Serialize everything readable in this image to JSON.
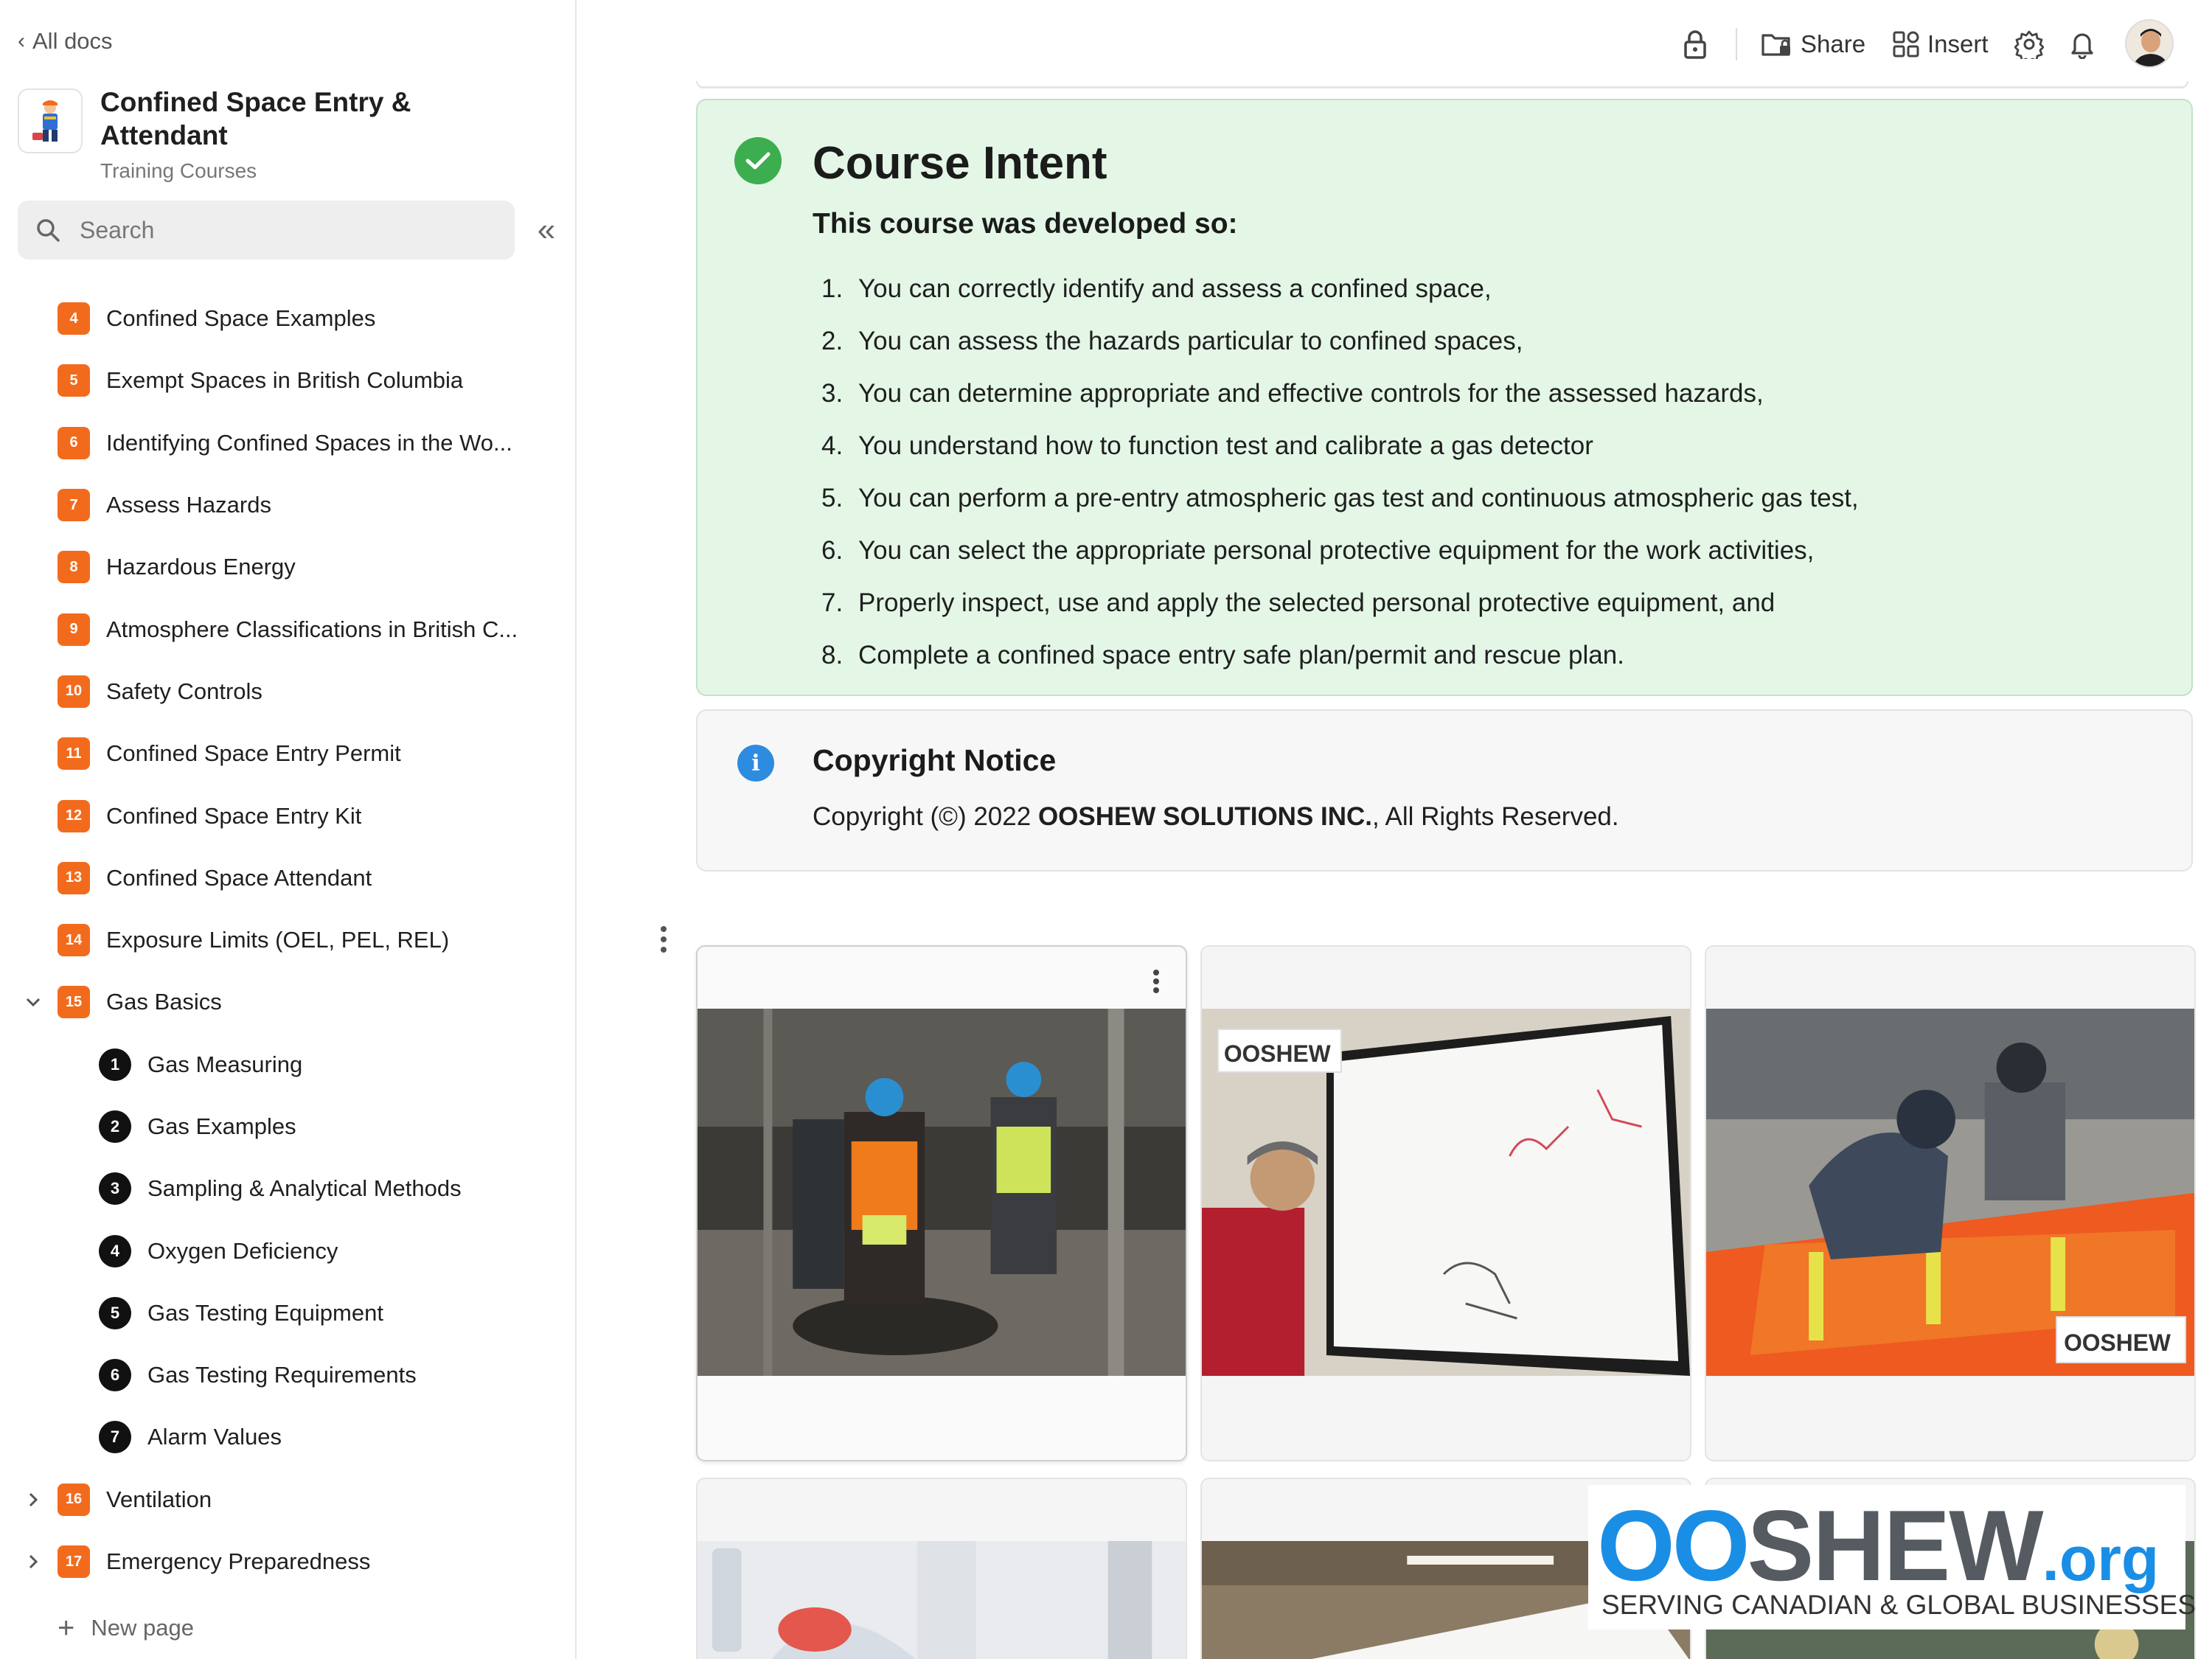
{
  "sidebar": {
    "back_label": "All docs",
    "doc_title": "Confined Space Entry & Attendant",
    "doc_subtitle": "Training Courses",
    "search_placeholder": "Search",
    "items": [
      {
        "num": "4",
        "label": "Confined Space Examples"
      },
      {
        "num": "5",
        "label": "Exempt Spaces in British Columbia"
      },
      {
        "num": "6",
        "label": "Identifying Confined Spaces in the Wo..."
      },
      {
        "num": "7",
        "label": "Assess Hazards"
      },
      {
        "num": "8",
        "label": "Hazardous Energy"
      },
      {
        "num": "9",
        "label": "Atmosphere Classifications in British C..."
      },
      {
        "num": "10",
        "label": "Safety Controls"
      },
      {
        "num": "11",
        "label": "Confined Space Entry Permit"
      },
      {
        "num": "12",
        "label": "Confined Space Entry Kit"
      },
      {
        "num": "13",
        "label": "Confined Space Attendant"
      },
      {
        "num": "14",
        "label": "Exposure Limits (OEL, PEL, REL)"
      },
      {
        "num": "15",
        "label": "Gas Basics"
      },
      {
        "num": "1",
        "label": "Gas Measuring"
      },
      {
        "num": "2",
        "label": "Gas Examples"
      },
      {
        "num": "3",
        "label": "Sampling & Analytical Methods"
      },
      {
        "num": "4",
        "label": "Oxygen Deficiency"
      },
      {
        "num": "5",
        "label": "Gas Testing Equipment"
      },
      {
        "num": "6",
        "label": "Gas Testing Requirements"
      },
      {
        "num": "7",
        "label": "Alarm Values"
      },
      {
        "num": "16",
        "label": "Ventilation"
      },
      {
        "num": "17",
        "label": "Emergency Preparedness"
      }
    ],
    "new_page_label": "New page"
  },
  "topbar": {
    "share_label": "Share",
    "insert_label": "Insert"
  },
  "intent": {
    "title": "Course Intent",
    "subtitle": "This course was developed so:",
    "items": [
      {
        "num": "1.",
        "text": "You can correctly identify and assess a confined space,"
      },
      {
        "num": "2.",
        "text": "You can assess the hazards particular to confined spaces,"
      },
      {
        "num": "3.",
        "text": "You can determine appropriate and effective controls for the assessed hazards,"
      },
      {
        "num": "4.",
        "text": "You understand how to function test and calibrate a gas detector"
      },
      {
        "num": "5.",
        "text": "You can perform a pre-entry atmospheric gas test and continuous atmospheric gas test,"
      },
      {
        "num": "6.",
        "text": "You can select the appropriate personal protective equipment for the work activities,"
      },
      {
        "num": "7.",
        "text": "Properly inspect, use and apply the selected personal protective equipment, and"
      },
      {
        "num": "8.",
        "text": "Complete a confined space entry safe plan/permit and rescue plan."
      }
    ]
  },
  "copyright": {
    "title": "Copyright Notice",
    "text_prefix": "Copyright (©) 2022 ",
    "company": "OOSHEW SOLUTIONS INC.",
    "text_suffix": ", All Rights Reserved."
  },
  "photos": {
    "watermark_small": "OOSHEW"
  },
  "brand": {
    "logo_oo": "OO",
    "logo_shew": "SHEW",
    "logo_tld": ".org",
    "tagline": "SERVING CANADIAN & GLOBAL BUSINESSES"
  },
  "colors": {
    "accent_orange": "#f26b1d",
    "intent_bg": "#e4f7e7",
    "check_green": "#3cae4f",
    "info_blue": "#2d8be0",
    "brand_blue": "#1a8ee5"
  }
}
